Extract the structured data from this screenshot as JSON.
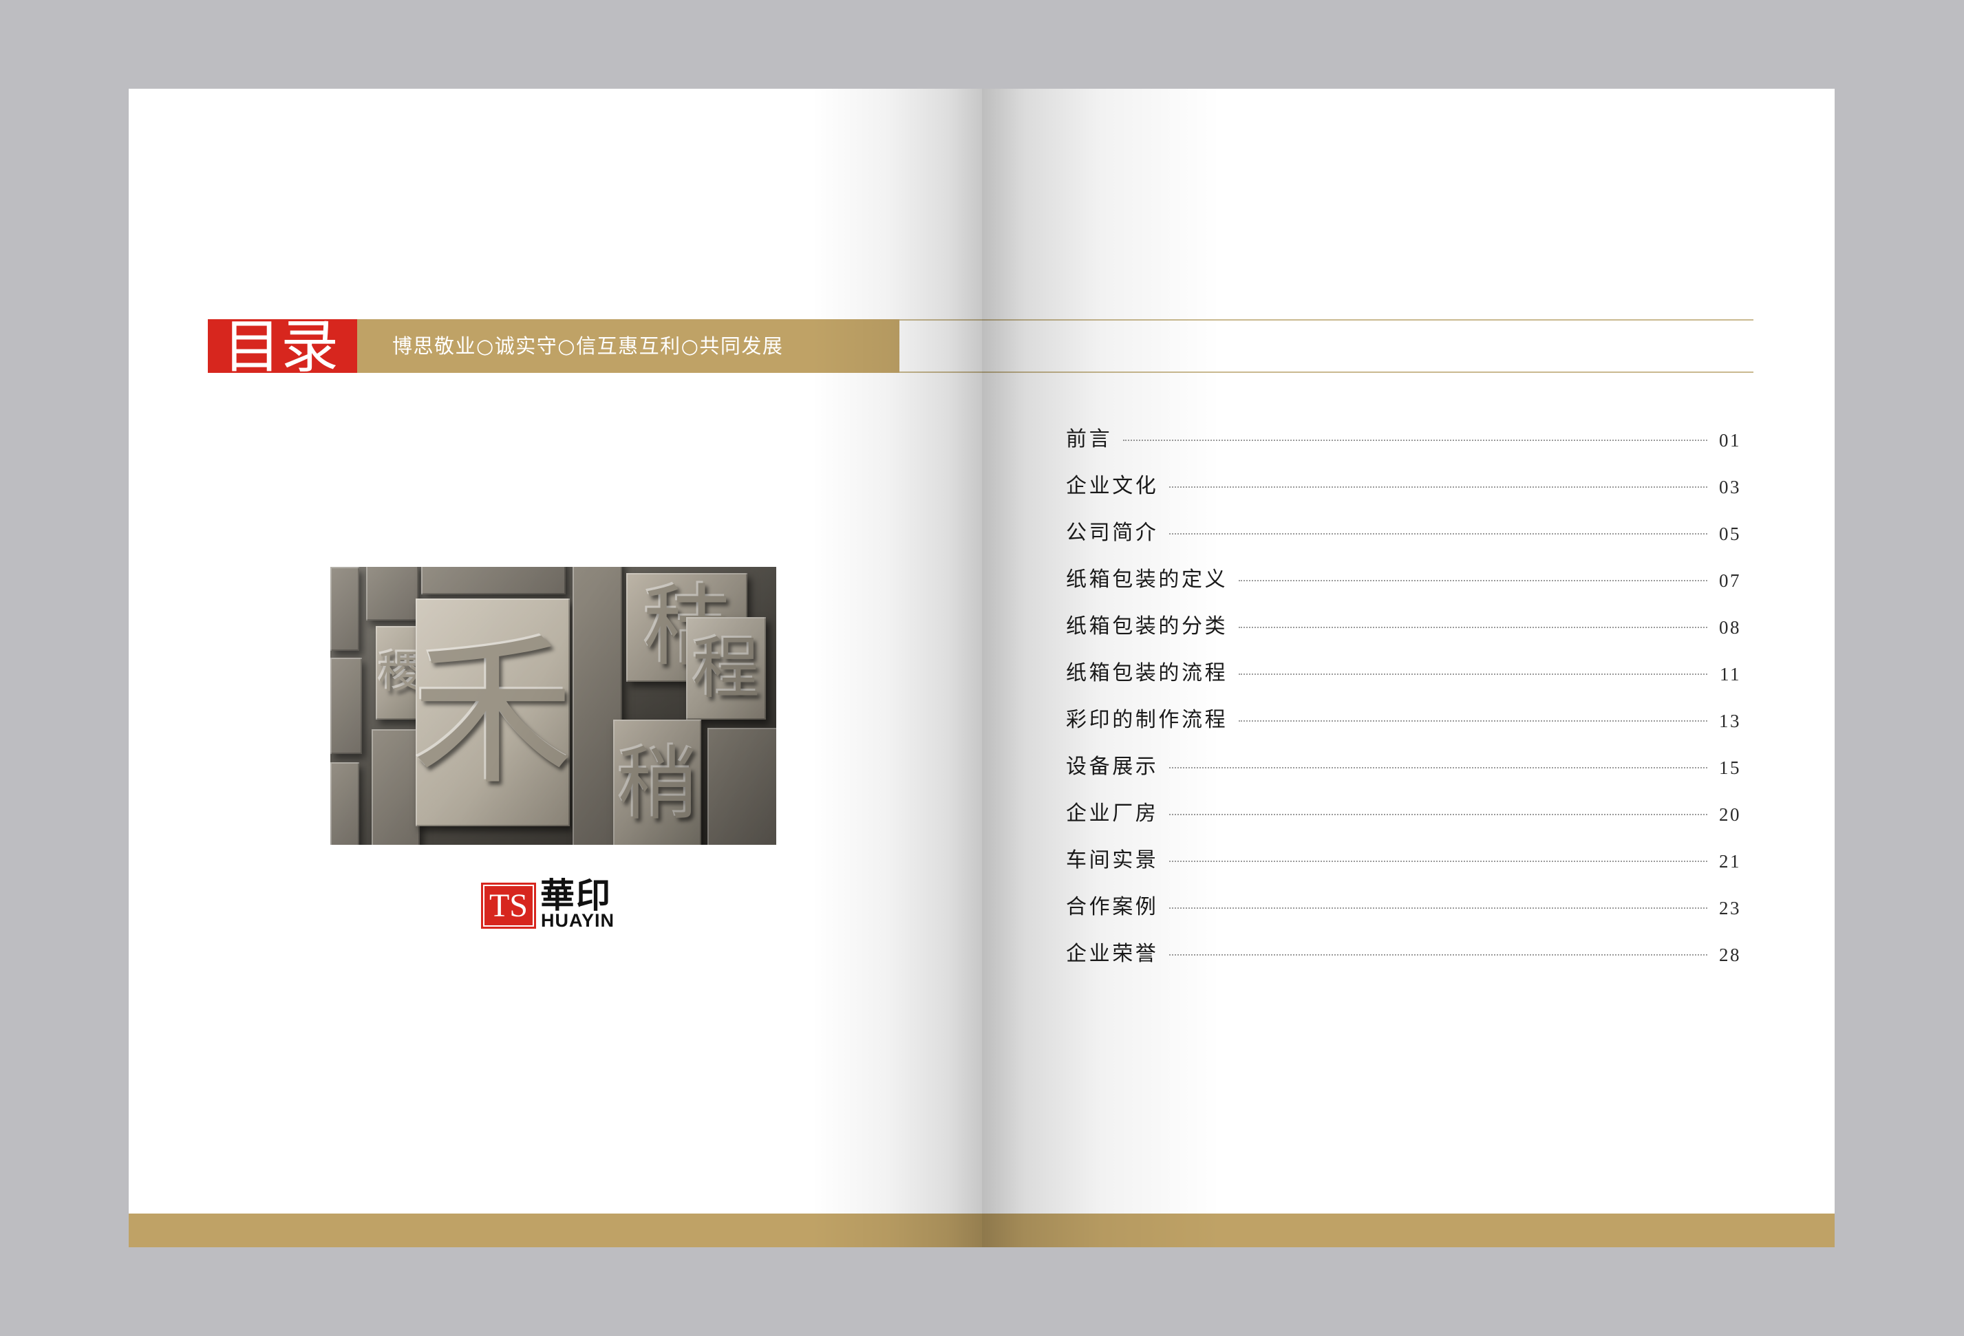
{
  "header": {
    "title": "目录",
    "slogan": "博思敬业○诚实守○信互惠互利○共同发展"
  },
  "photo": {
    "glyphs": [
      "稷",
      "禾",
      "秸",
      "程",
      "稍"
    ]
  },
  "logo": {
    "mark": "TS",
    "chinese": "華印",
    "latin": "HUAYIN"
  },
  "toc": [
    {
      "title": "前言",
      "page": "01"
    },
    {
      "title": "企业文化",
      "page": "03"
    },
    {
      "title": "公司简介",
      "page": "05"
    },
    {
      "title": "纸箱包装的定义",
      "page": "07"
    },
    {
      "title": "纸箱包装的分类",
      "page": "08"
    },
    {
      "title": "纸箱包装的流程",
      "page": "11"
    },
    {
      "title": "彩印的制作流程",
      "page": "13"
    },
    {
      "title": "设备展示",
      "page": "15"
    },
    {
      "title": "企业厂房",
      "page": "20"
    },
    {
      "title": "车间实景",
      "page": "21"
    },
    {
      "title": "合作案例",
      "page": "23"
    },
    {
      "title": "企业荣誉",
      "page": "28"
    }
  ],
  "colors": {
    "accent_red": "#d7261e",
    "gold": "#bfa266",
    "background": "#bdbdc1",
    "rule_line": "#c9b98f"
  }
}
